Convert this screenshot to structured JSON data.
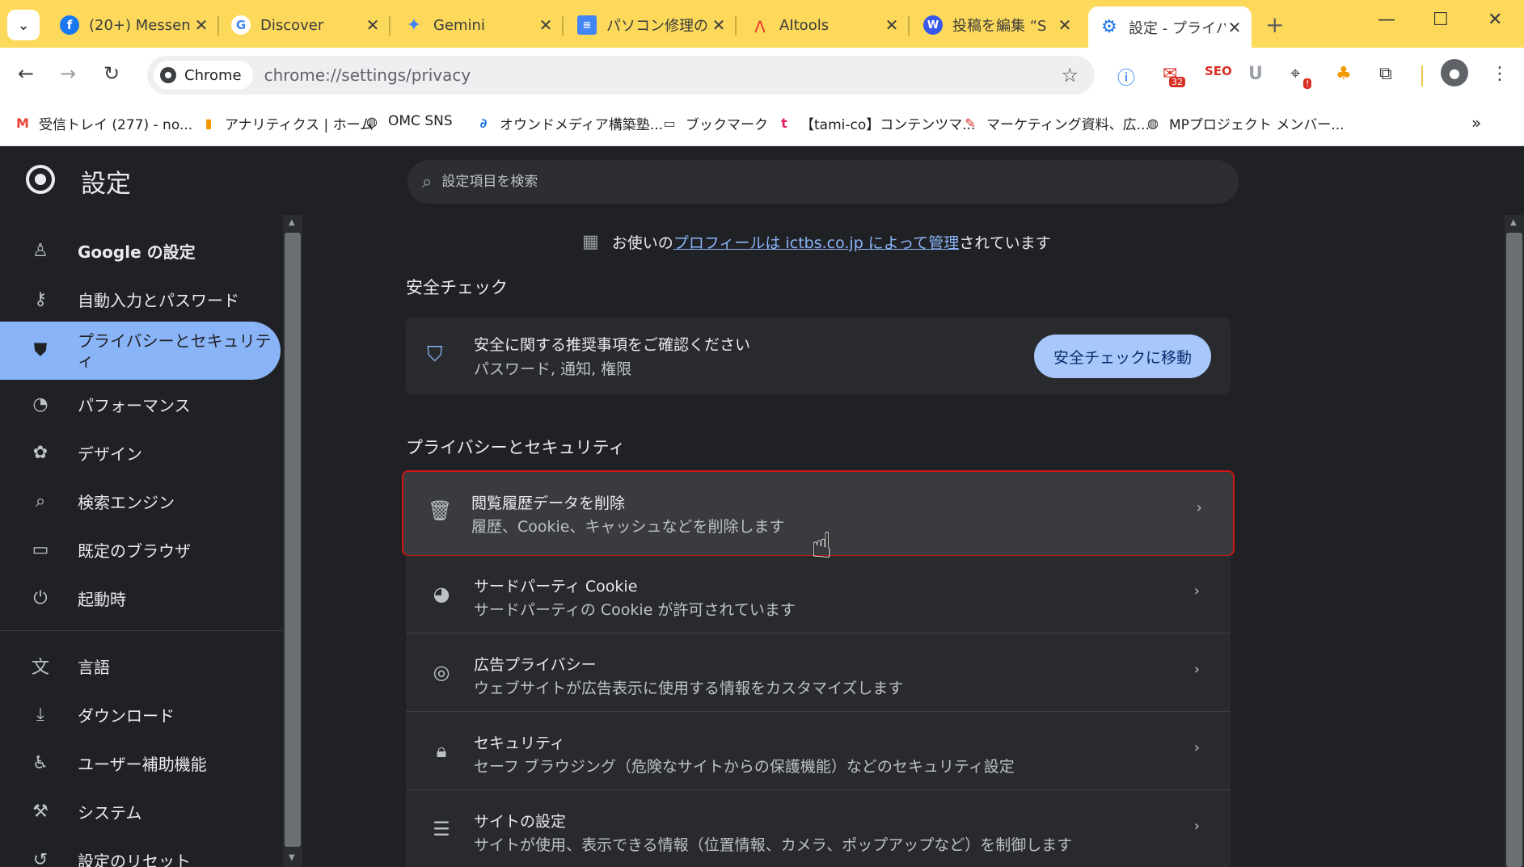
{
  "tabs": [
    {
      "title": "(20+) Messen",
      "icon": "facebook-icon",
      "color": "#1877f2"
    },
    {
      "title": "Discover",
      "icon": "google-icon",
      "color": "#4285f4"
    },
    {
      "title": "Gemini",
      "icon": "gemini-icon",
      "color": "#4285f4"
    },
    {
      "title": "パソコン修理の",
      "icon": "docs-icon",
      "color": "#4285f4"
    },
    {
      "title": "AItools",
      "icon": "aitools-icon",
      "color": "#ea4335"
    },
    {
      "title": "投稿を編集 “S",
      "icon": "wordpress-icon",
      "color": "#3858e9"
    },
    {
      "title": "設定 - プライバ",
      "icon": "gear-icon",
      "color": "#1a73e8"
    }
  ],
  "toolbar": {
    "chip_label": "Chrome",
    "url": "chrome://settings/privacy",
    "extension_badges": {
      "mail": "32",
      "cursor": "!"
    }
  },
  "bookmarks": [
    {
      "label": "受信トレイ (277) - no...",
      "icon": "gmail-icon"
    },
    {
      "label": "アナリティクス | ホーム",
      "icon": "analytics-icon"
    },
    {
      "label": "OMC SNS",
      "icon": "globe-icon"
    },
    {
      "label": "オウンドメディア構築塾...",
      "icon": "link-icon"
    },
    {
      "label": "ブックマーク",
      "icon": "folder-icon"
    },
    {
      "label": "【tami-co】コンテンツマ...",
      "icon": "tamico-icon"
    },
    {
      "label": "マーケティング資料、広...",
      "icon": "pdf-icon"
    },
    {
      "label": "MPプロジェクト メンバー...",
      "icon": "globe-icon"
    }
  ],
  "settings": {
    "title": "設定",
    "search_placeholder": "設定項目を検索"
  },
  "sidebar": [
    {
      "label": "Google の設定",
      "icon": "person-icon"
    },
    {
      "label": "自動入力とパスワード",
      "icon": "key-icon"
    },
    {
      "label": "プライバシーとセキュリティ",
      "icon": "shield-icon",
      "active": true
    },
    {
      "label": "パフォーマンス",
      "icon": "gauge-icon"
    },
    {
      "label": "デザイン",
      "icon": "palette-icon"
    },
    {
      "label": "検索エンジン",
      "icon": "search-icon"
    },
    {
      "label": "既定のブラウザ",
      "icon": "browser-icon"
    },
    {
      "label": "起動時",
      "icon": "power-icon"
    },
    {
      "label": "言語",
      "icon": "translate-icon"
    },
    {
      "label": "ダウンロード",
      "icon": "download-icon"
    },
    {
      "label": "ユーザー補助機能",
      "icon": "accessibility-icon"
    },
    {
      "label": "システム",
      "icon": "wrench-icon"
    },
    {
      "label": "設定のリセット",
      "icon": "reset-icon"
    }
  ],
  "managed": {
    "prefix": "お使いの",
    "link": "プロフィールは ictbs.co.jp によって管理",
    "suffix": "されています"
  },
  "safety": {
    "section_title": "安全チェック",
    "title": "安全に関する推奨事項をご確認ください",
    "subtitle": "パスワード, 通知, 権限",
    "button": "安全チェックに移動"
  },
  "privacy": {
    "section_title": "プライバシーとセキュリティ",
    "rows": [
      {
        "title": "閲覧履歴データを削除",
        "subtitle": "履歴、Cookie、キャッシュなどを削除します",
        "icon": "trash-icon"
      },
      {
        "title": "サードパーティ Cookie",
        "subtitle": "サードパーティの Cookie が許可されています",
        "icon": "cookie-icon"
      },
      {
        "title": "広告プライバシー",
        "subtitle": "ウェブサイトが広告表示に使用する情報をカスタマイズします",
        "icon": "ad-privacy-icon"
      },
      {
        "title": "セキュリティ",
        "subtitle": "セーフ ブラウジング（危険なサイトからの保護機能）などのセキュリティ設定",
        "icon": "lock-icon"
      },
      {
        "title": "サイトの設定",
        "subtitle": "サイトが使用、表示できる情報（位置情報、カメラ、ポップアップなど）を制御します",
        "icon": "tune-icon"
      }
    ]
  }
}
